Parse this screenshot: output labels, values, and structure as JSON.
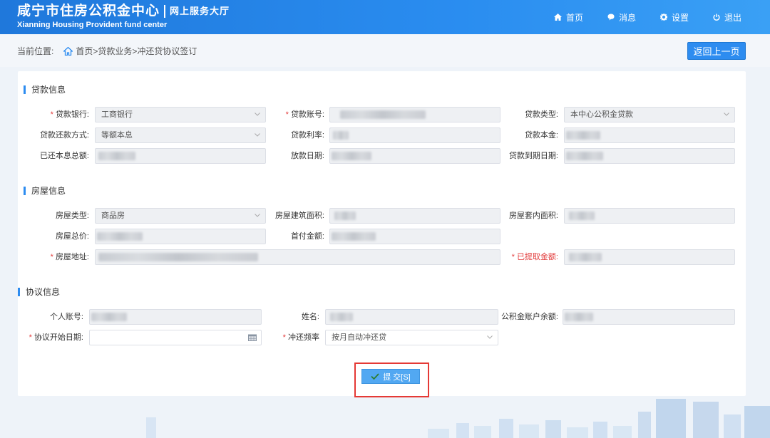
{
  "header": {
    "title_cn": "咸宁市住房公积金中心",
    "title_sub": "网上服务大厅",
    "title_en": "Xianning Housing Provident fund center",
    "nav": [
      {
        "label": "首页",
        "icon": "home-icon"
      },
      {
        "label": "消息",
        "icon": "message-icon"
      },
      {
        "label": "设置",
        "icon": "gear-icon"
      },
      {
        "label": "退出",
        "icon": "power-icon"
      }
    ]
  },
  "breadcrumb": {
    "prefix": "当前位置:",
    "home": "首页",
    "sep1": " > ",
    "level1": "贷款业务",
    "sep2": " > ",
    "level2": "冲还贷协议签订"
  },
  "back_button": "返回上一页",
  "sections": {
    "loan": {
      "title": "贷款信息",
      "bank_label": "贷款银行:",
      "bank_value": "工商银行",
      "account_label": "贷款账号:",
      "type_label": "贷款类型:",
      "type_value": "本中心公积金贷款",
      "repay_method_label": "贷款还款方式:",
      "repay_method_value": "等额本息",
      "rate_label": "贷款利率:",
      "principal_label": "贷款本金:",
      "repaid_label": "已还本息总额:",
      "issue_date_label": "放款日期:",
      "due_date_label": "贷款到期日期:"
    },
    "house": {
      "title": "房屋信息",
      "type_label": "房屋类型:",
      "type_value": "商品房",
      "area_label": "房屋建筑面积:",
      "inner_area_label": "房屋套内面积:",
      "total_price_label": "房屋总价:",
      "down_payment_label": "首付金额:",
      "address_label": "房屋地址:",
      "withdrawn_label": "已提取金额:"
    },
    "agreement": {
      "title": "协议信息",
      "personal_account_label": "个人账号:",
      "name_label": "姓名:",
      "balance_label": "公积金账户余额:",
      "start_date_label": "协议开始日期:",
      "start_date_value": "",
      "frequency_label": "冲还频率",
      "frequency_value": "按月自动冲还贷"
    }
  },
  "submit_label": "提 交[S]",
  "colors": {
    "header_blue": "#1f78db",
    "button_blue": "#2d8cf0",
    "required_red": "#e23b3b",
    "highlight_red": "#e53935"
  }
}
